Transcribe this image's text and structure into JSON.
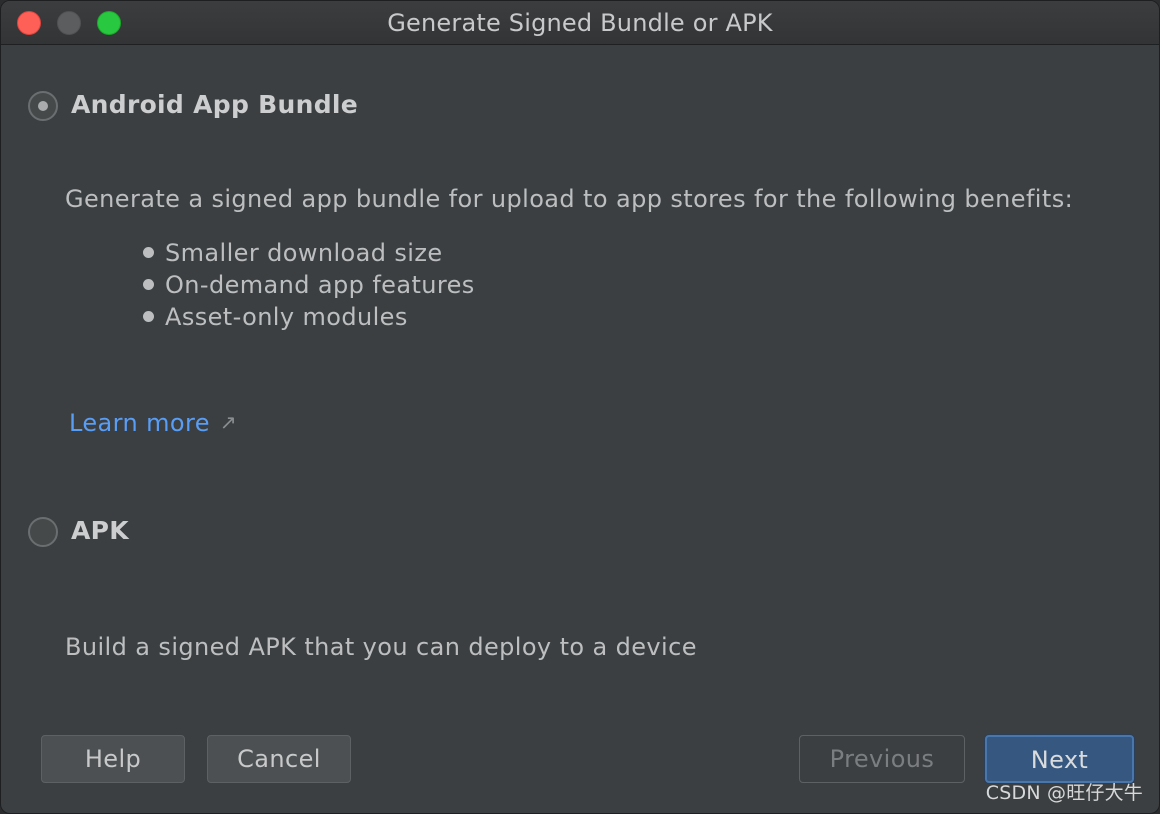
{
  "window": {
    "title": "Generate Signed Bundle or APK"
  },
  "options": {
    "bundle": {
      "label": "Android App Bundle",
      "selected": true,
      "description": "Generate a signed app bundle for upload to app stores for the following benefits:",
      "benefits": [
        "Smaller download size",
        "On-demand app features",
        "Asset-only modules"
      ],
      "learn_more": "Learn more"
    },
    "apk": {
      "label": "APK",
      "selected": false,
      "description": "Build a signed APK that you can deploy to a device"
    }
  },
  "buttons": {
    "help": "Help",
    "cancel": "Cancel",
    "previous": "Previous",
    "next": "Next"
  },
  "watermark": "CSDN @旺仔大牛",
  "colors": {
    "background": "#3c3f41",
    "link": "#589df6",
    "primary_button": "#365880"
  },
  "icons": {
    "external_link": "arrow-up-right-icon"
  }
}
